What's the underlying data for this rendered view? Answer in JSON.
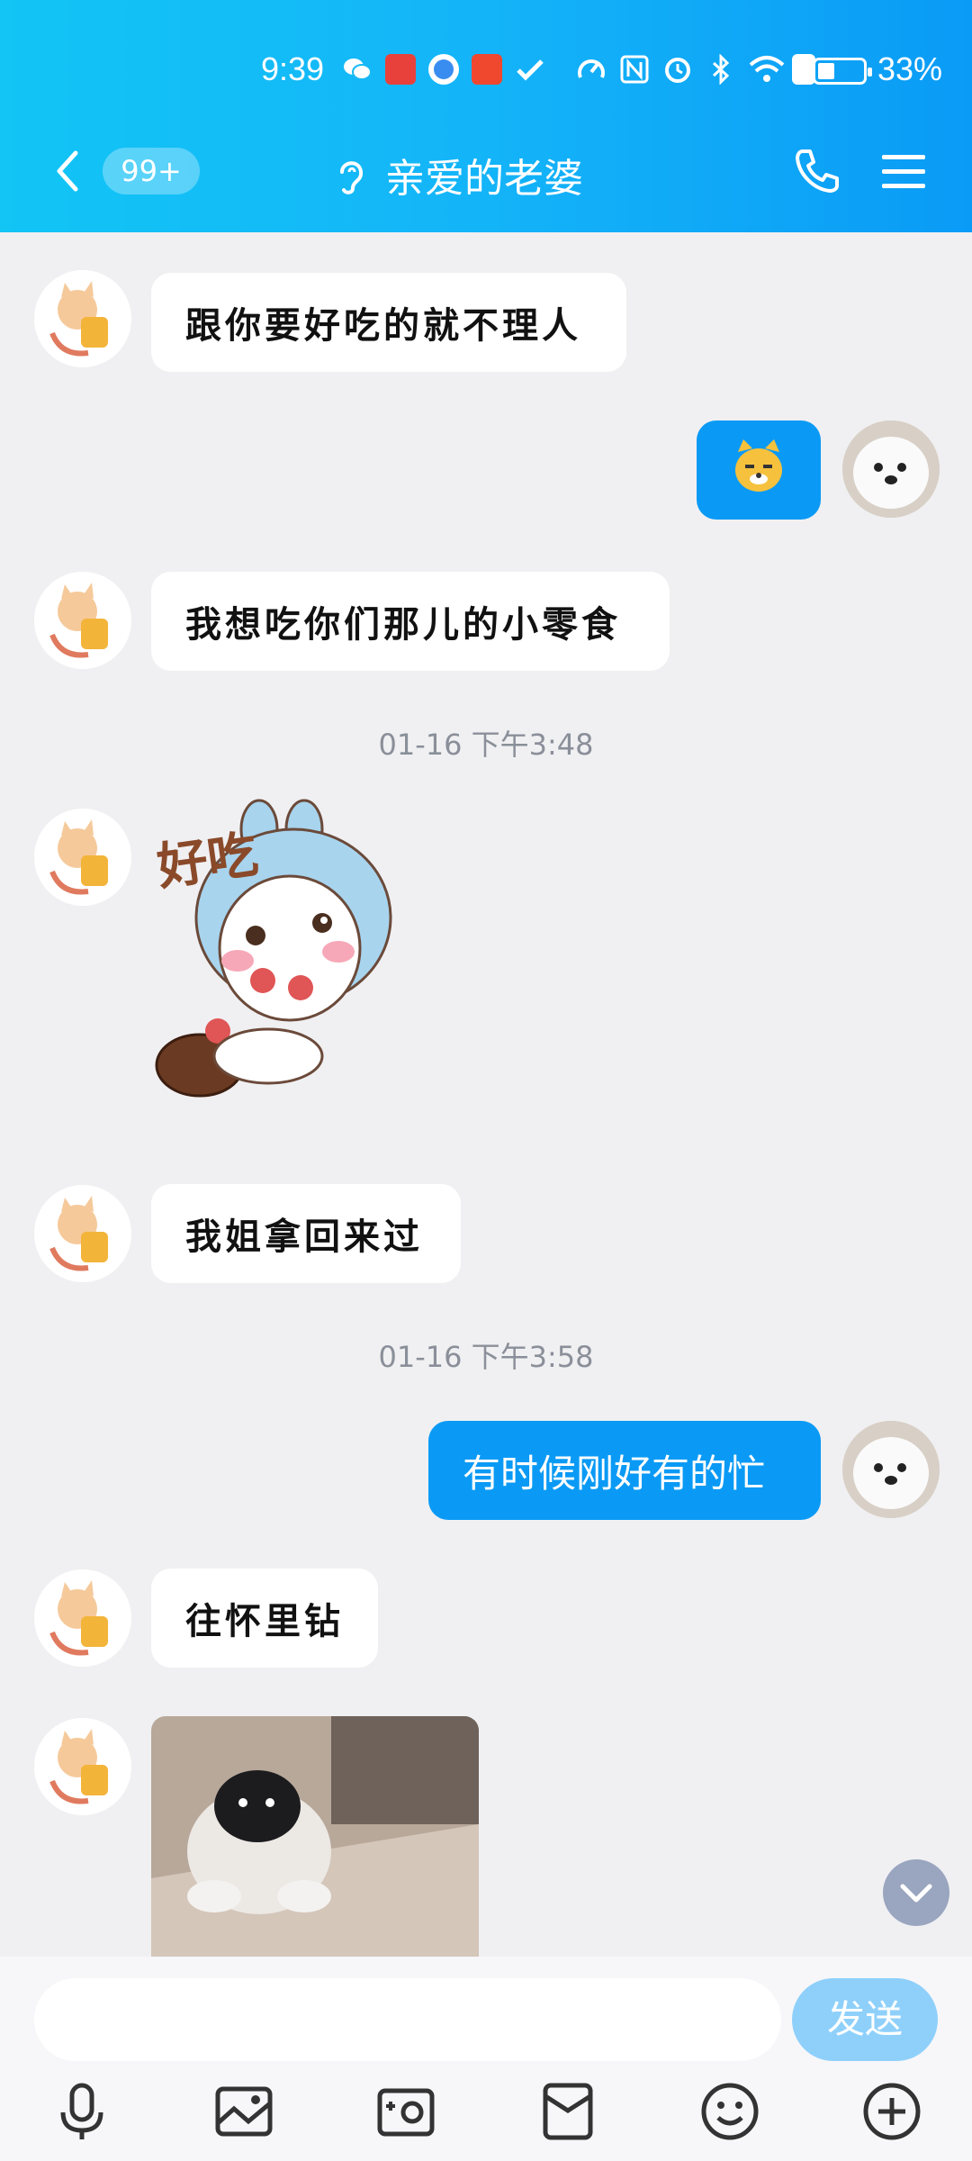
{
  "status_bar": {
    "time": "9:39",
    "battery_percent": "33%",
    "battery_level": 0.33
  },
  "header": {
    "unread_badge": "99+",
    "title": "亲爱的老婆",
    "icons": [
      "back-icon",
      "ear-icon",
      "phone-icon",
      "menu-icon"
    ]
  },
  "messages": [
    {
      "side": "left",
      "type": "text",
      "text": "跟你要好吃的就不理人"
    },
    {
      "side": "right",
      "type": "emoji",
      "emoji": "cat-face-emoji"
    },
    {
      "side": "left",
      "type": "text",
      "text": "我想吃你们那儿的小零食"
    },
    {
      "type": "timestamp",
      "text": "01-16 下午3:48"
    },
    {
      "side": "left",
      "type": "sticker",
      "sticker_text": "好吃",
      "sticker": "bunny-eating-sticker"
    },
    {
      "side": "left",
      "type": "text",
      "text": "我姐拿回来过"
    },
    {
      "type": "timestamp",
      "text": "01-16 下午3:58"
    },
    {
      "side": "right",
      "type": "text",
      "text": "有时候刚好有的忙"
    },
    {
      "side": "left",
      "type": "text",
      "text": "往怀里钻"
    },
    {
      "side": "left",
      "type": "image",
      "image": "dog-photo"
    }
  ],
  "composer": {
    "placeholder": "",
    "send_label": "发送"
  },
  "toolbar": {
    "tools": [
      "microphone-icon",
      "gallery-icon",
      "camera-icon",
      "red-packet-icon",
      "emoji-icon",
      "plus-icon"
    ]
  },
  "colors": {
    "header_start": "#12c5f5",
    "header_end": "#0a9bf6",
    "outgoing_bubble": "#0a9af5",
    "send_button": "#8fd0fb",
    "chat_background": "#f0f0f2"
  }
}
